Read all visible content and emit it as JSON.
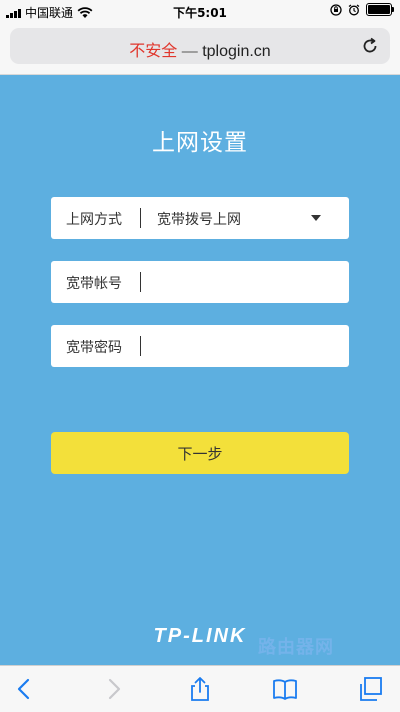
{
  "status_bar": {
    "carrier": "中国联通",
    "time": "下午5:01"
  },
  "address_bar": {
    "insecure_label": "不安全",
    "separator": "—",
    "domain": "tplogin.cn"
  },
  "page": {
    "title": "上网设置",
    "fields": [
      {
        "label": "上网方式",
        "value": "宽带拨号上网",
        "type": "select"
      },
      {
        "label": "宽带帐号",
        "value": "",
        "type": "text"
      },
      {
        "label": "宽带密码",
        "value": "",
        "type": "password"
      }
    ],
    "next_button_label": "下一步",
    "brand": "TP-LINK",
    "watermark": "路由器网"
  },
  "colors": {
    "page_background": "#5dafe0",
    "button_yellow": "#f3e03a",
    "insecure_red": "#e0362c"
  },
  "toolbar_icons": [
    "back-icon",
    "forward-icon",
    "share-icon",
    "bookmarks-icon",
    "tabs-icon"
  ]
}
